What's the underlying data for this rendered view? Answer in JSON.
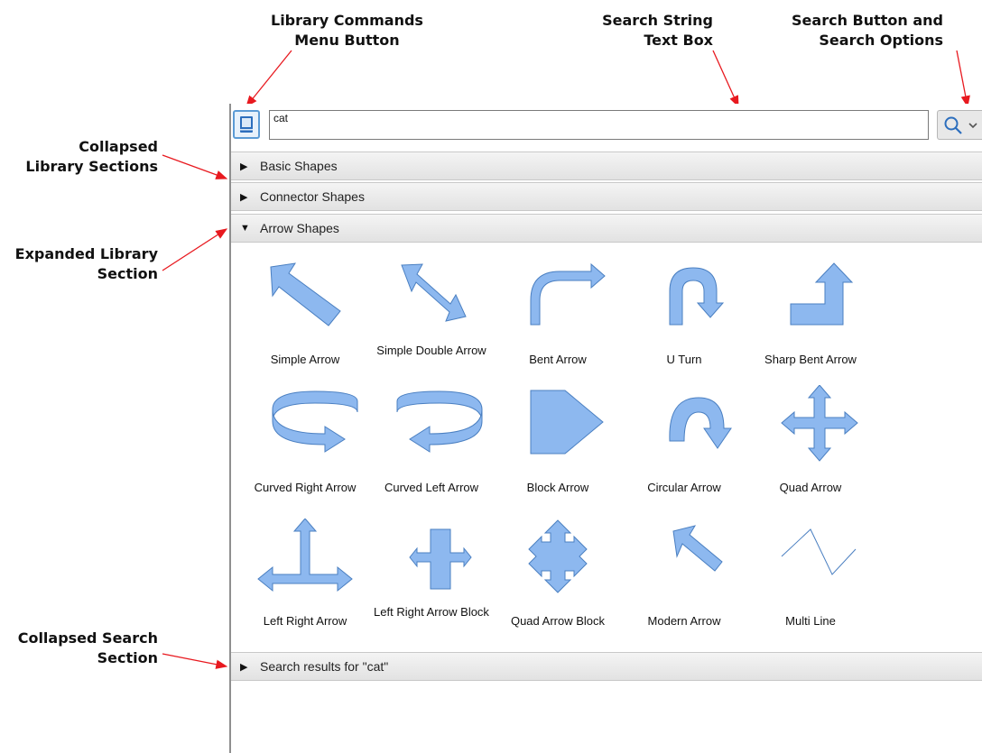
{
  "annotations": {
    "library_menu": [
      "Library Commands",
      "Menu Button"
    ],
    "search_box": [
      "Search String",
      "Text Box"
    ],
    "search_button": [
      "Search Button and",
      "Search Options"
    ],
    "collapsed_sections": [
      "Collapsed",
      "Library Sections"
    ],
    "expanded_section": [
      "Expanded Library",
      "Section"
    ],
    "collapsed_search": [
      "Collapsed Search",
      "Section"
    ]
  },
  "search": {
    "value": "cat"
  },
  "sections": {
    "basic": "Basic Shapes",
    "connector": "Connector Shapes",
    "arrow": "Arrow Shapes",
    "search_results": "Search results for \"cat\""
  },
  "shapes": [
    "Simple Arrow",
    "Simple Double Arrow",
    "Bent Arrow",
    "U Turn",
    "Sharp Bent Arrow",
    "Curved Right Arrow",
    "Curved Left Arrow",
    "Block Arrow",
    "Circular Arrow",
    "Quad Arrow",
    "Left Right Arrow",
    "Left Right Arrow Block",
    "Quad Arrow Block",
    "Modern Arrow",
    "Multi Line"
  ],
  "icons": {
    "library": "book-icon",
    "search": "magnifier-icon",
    "options": "chevron-down-icon",
    "collapsed": "triangle-right-icon",
    "expanded": "triangle-down-icon"
  },
  "colors": {
    "shape_fill": "#8db8ef",
    "shape_stroke": "#4a7fc1",
    "annotation_arrow": "#e8191f",
    "accent": "#5b9bd5"
  }
}
